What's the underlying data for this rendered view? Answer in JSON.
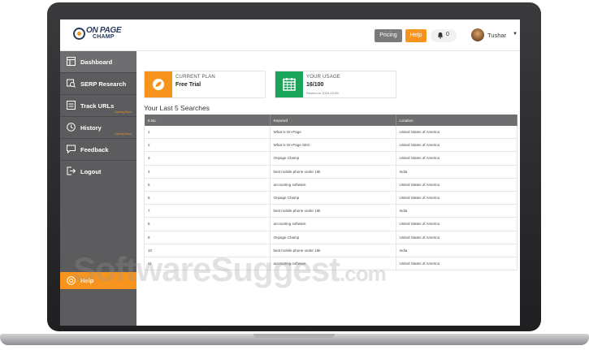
{
  "header": {
    "logo_line1": "ON PAGE",
    "logo_line2": "CHAMP",
    "pricing_label": "Pricing",
    "help_label": "Help",
    "notification_count": "0",
    "user_name": "Tushar"
  },
  "sidebar": {
    "items": [
      {
        "label": "Dashboard",
        "icon": "dashboard-icon",
        "sub": ""
      },
      {
        "label": "SERP Research",
        "icon": "serp-icon",
        "sub": ""
      },
      {
        "label": "Track URLs",
        "icon": "track-icon",
        "sub": "Coming Soon"
      },
      {
        "label": "History",
        "icon": "history-icon",
        "sub": "Coming Soon"
      },
      {
        "label": "Feedback",
        "icon": "feedback-icon",
        "sub": ""
      },
      {
        "label": "Logout",
        "icon": "logout-icon",
        "sub": ""
      }
    ],
    "help_label": "Help"
  },
  "plan_card": {
    "title": "CURRENT PLAN",
    "value": "Free Trial",
    "color": "#f7941d"
  },
  "usage_card": {
    "title": "YOUR USAGE",
    "value": "16/100",
    "note": "Resets on 2019-10-09",
    "color": "#1aa35a"
  },
  "searches": {
    "title": "Your Last 5 Searches",
    "columns": [
      "S.No.",
      "Keyword",
      "Location"
    ],
    "rows": [
      [
        "1",
        "What is On-Page",
        "United States of America"
      ],
      [
        "2",
        "What is On-Page SEO",
        "United States of America"
      ],
      [
        "3",
        "Onpage Champ",
        "United States of America"
      ],
      [
        "4",
        "best mobile phone under 15k",
        "India"
      ],
      [
        "5",
        "accounting software",
        "United States of America"
      ],
      [
        "6",
        "Onpage Champ",
        "United States of America"
      ],
      [
        "7",
        "best mobile phone under 15k",
        "India"
      ],
      [
        "8",
        "accounting software",
        "United States of America"
      ],
      [
        "9",
        "Onpage Champ",
        "United States of America"
      ],
      [
        "10",
        "best mobile phone under 15k",
        "India"
      ],
      [
        "11",
        "accounting software",
        "United States of America"
      ]
    ]
  },
  "watermark": {
    "text": "SoftwareSuggest",
    "suffix": ".com"
  }
}
